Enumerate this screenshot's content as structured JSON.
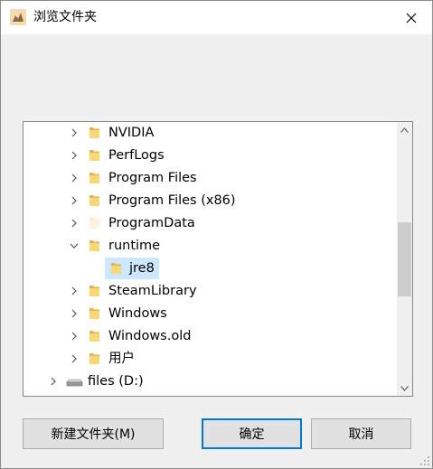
{
  "window": {
    "title": "浏览文件夹"
  },
  "tree": {
    "items": [
      {
        "label": "NVIDIA",
        "icon": "folder-icon",
        "expanded": false,
        "selected": false
      },
      {
        "label": "PerfLogs",
        "icon": "folder-icon",
        "expanded": false,
        "selected": false
      },
      {
        "label": "Program Files",
        "icon": "folder-icon",
        "expanded": false,
        "selected": false
      },
      {
        "label": "Program Files (x86)",
        "icon": "folder-icon",
        "expanded": false,
        "selected": false
      },
      {
        "label": "ProgramData",
        "icon": "folder-icon",
        "hidden": true,
        "expanded": false,
        "selected": false
      },
      {
        "label": "runtime",
        "icon": "folder-icon",
        "expanded": true,
        "selected": false
      },
      {
        "label": "jre8",
        "icon": "folder-icon",
        "selected": true
      },
      {
        "label": "SteamLibrary",
        "icon": "folder-icon",
        "expanded": false,
        "selected": false
      },
      {
        "label": "Windows",
        "icon": "folder-icon",
        "expanded": false,
        "selected": false
      },
      {
        "label": "Windows.old",
        "icon": "folder-icon",
        "expanded": false,
        "selected": false
      },
      {
        "label": "用户",
        "icon": "folder-icon",
        "expanded": false,
        "selected": false
      },
      {
        "label": "files (D:)",
        "icon": "drive-icon",
        "expanded": false,
        "selected": false
      }
    ]
  },
  "buttons": {
    "new_folder": "新建文件夹(M)",
    "ok": "确定",
    "cancel": "取消"
  },
  "colors": {
    "accent": "#0078d7",
    "selection": "#cce8ff",
    "folder": "#f8d775"
  }
}
